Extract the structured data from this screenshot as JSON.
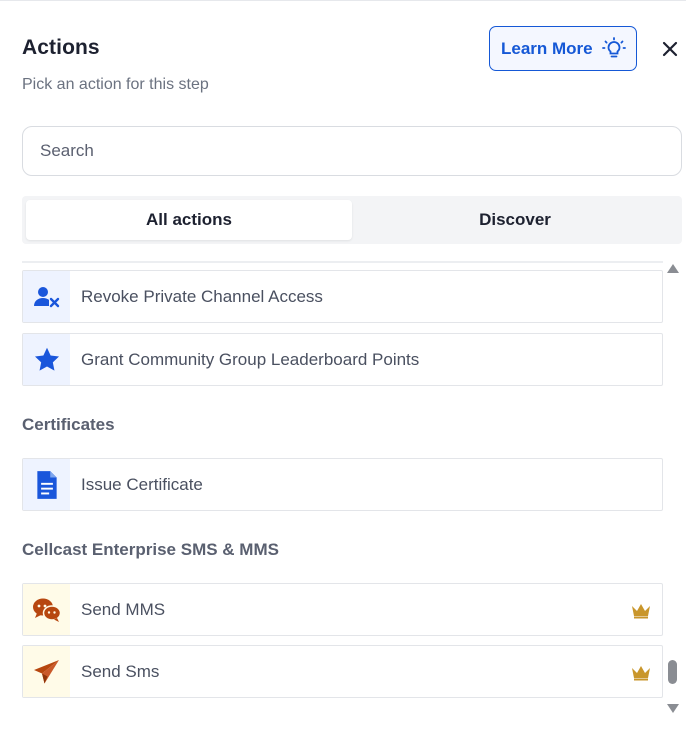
{
  "header": {
    "title": "Actions",
    "subtitle": "Pick an action for this step",
    "learn_more_label": "Learn More",
    "learn_more_icon": "lightbulb-icon",
    "close_icon": "close-icon"
  },
  "search": {
    "placeholder": "Search",
    "value": ""
  },
  "tabs": [
    {
      "label": "All actions",
      "active": true
    },
    {
      "label": "Discover",
      "active": false
    }
  ],
  "sections": [
    {
      "title": "",
      "items": [
        {
          "label": "Revoke Private Channel Access",
          "icon": "user-remove-icon",
          "premium": false
        },
        {
          "label": "Grant Community Group Leaderboard Points",
          "icon": "star-icon",
          "premium": false
        }
      ]
    },
    {
      "title": "Certificates",
      "items": [
        {
          "label": "Issue Certificate",
          "icon": "document-icon",
          "premium": false
        }
      ]
    },
    {
      "title": "Cellcast Enterprise SMS & MMS",
      "items": [
        {
          "label": "Send MMS",
          "icon": "chat-bubbles-icon",
          "premium": true
        },
        {
          "label": "Send Sms",
          "icon": "paper-plane-icon",
          "premium": true
        }
      ]
    }
  ],
  "colors": {
    "accent": "#1558d6",
    "action_icon_blue": "#1a56db",
    "sms_icon_orange": "#b7470f",
    "premium_crown": "#c9962b"
  }
}
